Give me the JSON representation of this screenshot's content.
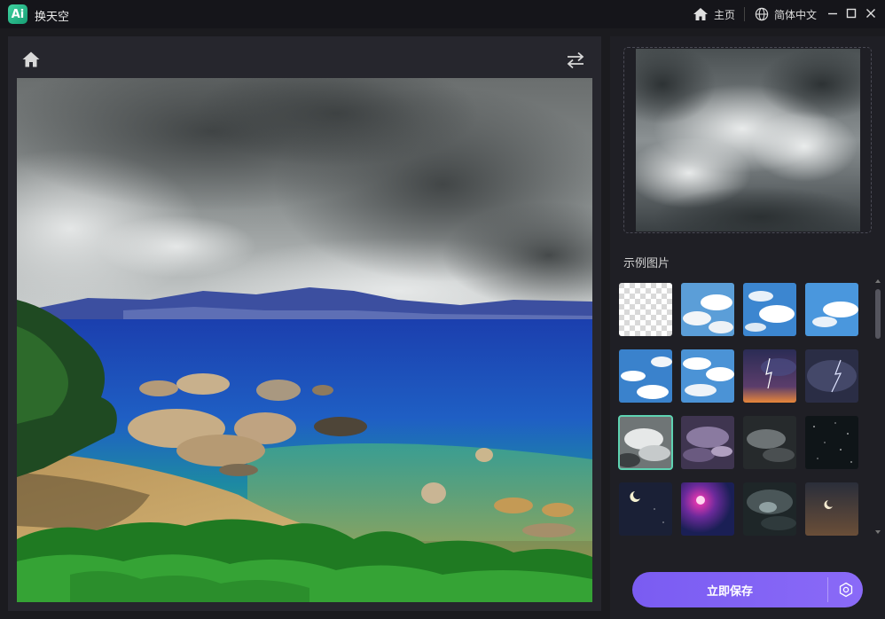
{
  "titlebar": {
    "logo_text": "Ai",
    "app_title": "换天空",
    "home_label": "主页",
    "language_label": "简体中文"
  },
  "right_panel": {
    "examples_label": "示例图片",
    "save_label": "立即保存",
    "thumbnails": [
      {
        "name": "transparent",
        "icon": "transparent-icon"
      },
      {
        "name": "blue-sky-clouds-1"
      },
      {
        "name": "blue-sky-clouds-2"
      },
      {
        "name": "blue-sky-clouds-3"
      },
      {
        "name": "blue-sky-clouds-4"
      },
      {
        "name": "blue-sky-clouds-5"
      },
      {
        "name": "sunset-storm"
      },
      {
        "name": "lightning-night"
      },
      {
        "name": "grey-clouds",
        "selected": true
      },
      {
        "name": "purple-clouds"
      },
      {
        "name": "dark-clouds"
      },
      {
        "name": "starry-night"
      },
      {
        "name": "moon-night"
      },
      {
        "name": "pink-moon-nebula"
      },
      {
        "name": "dark-storm"
      },
      {
        "name": "moon-dusk"
      }
    ]
  },
  "colors": {
    "accent": "#7a5cf2",
    "selected_outline": "#5fd3b2",
    "logo": "#2bbf8a",
    "background": "#1b1b1f"
  }
}
